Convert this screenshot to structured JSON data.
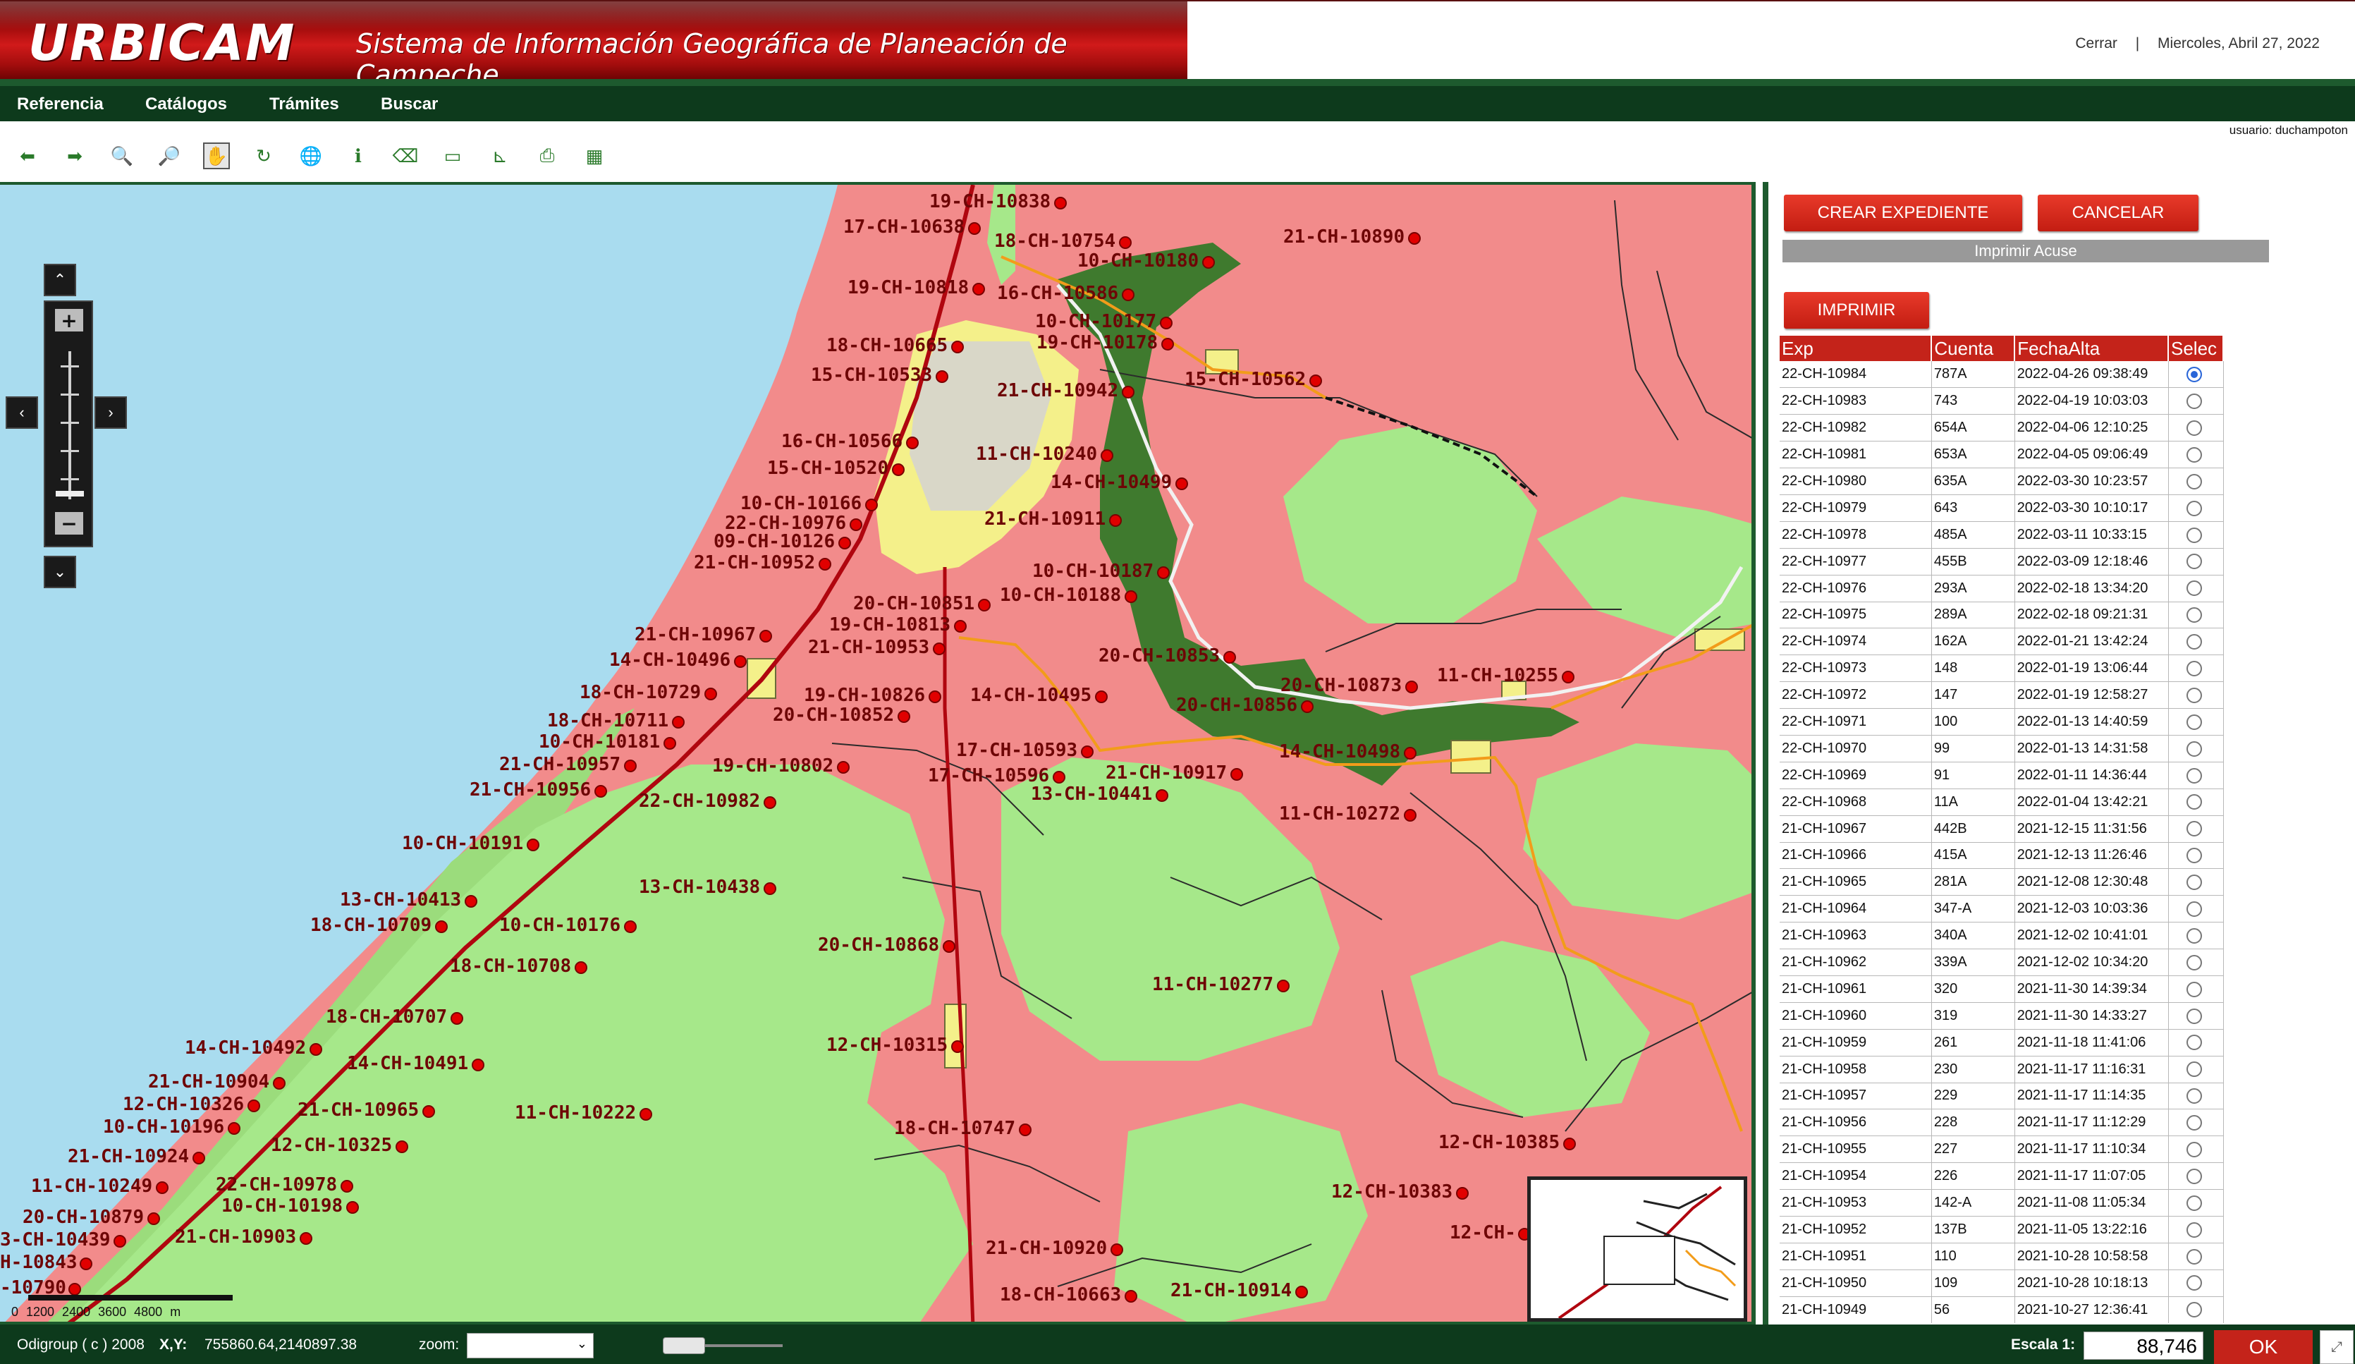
{
  "header": {
    "logo": "URBICAM",
    "subtitle": "Sistema de Información Geográfica de Planeación de Campeche",
    "close_link": "Cerrar",
    "separator": "|",
    "date": "Miercoles, Abril 27, 2022"
  },
  "menu": {
    "items": [
      "Referencia",
      "Catálogos",
      "Trámites",
      "Buscar"
    ]
  },
  "user_label": "usuario: duchampoton",
  "toolbar": {
    "tools": [
      {
        "icon": "arrow-left-icon",
        "glyph": "⬅"
      },
      {
        "icon": "arrow-right-icon",
        "glyph": "➡"
      },
      {
        "icon": "zoom-in-icon",
        "glyph": "🔍"
      },
      {
        "icon": "zoom-out-icon",
        "glyph": "🔎"
      },
      {
        "icon": "pan-hand-icon",
        "glyph": "✋"
      },
      {
        "icon": "refresh-icon",
        "glyph": "↻"
      },
      {
        "icon": "globe-icon",
        "glyph": "🌐"
      },
      {
        "icon": "info-icon",
        "glyph": "ℹ"
      },
      {
        "icon": "eraser-icon",
        "glyph": "⌫"
      },
      {
        "icon": "measure-distance-icon",
        "glyph": "▭"
      },
      {
        "icon": "measure-area-icon",
        "glyph": "⊾"
      },
      {
        "icon": "print-icon",
        "glyph": "⎙"
      },
      {
        "icon": "legend-icon",
        "glyph": "▦"
      }
    ]
  },
  "map": {
    "labels": [
      [
        "19-CH-10838",
        1318,
        290
      ],
      [
        "17-CH-10638",
        1196,
        326
      ],
      [
        "18-CH-10754",
        1410,
        346
      ],
      [
        "10-CH-10180",
        1528,
        374
      ],
      [
        "21-CH-10890",
        1820,
        340
      ],
      [
        "19-CH-10818",
        1202,
        412
      ],
      [
        "16-CH-10586",
        1414,
        420
      ],
      [
        "10-CH-10177",
        1468,
        460
      ],
      [
        "19-CH-10178",
        1470,
        490
      ],
      [
        "18-CH-10665",
        1172,
        494
      ],
      [
        "15-CH-10533",
        1150,
        536
      ],
      [
        "15-CH-10562",
        1680,
        542
      ],
      [
        "21-CH-10942",
        1414,
        558
      ],
      [
        "16-CH-10566",
        1108,
        630
      ],
      [
        "15-CH-10520",
        1088,
        668
      ],
      [
        "11-CH-10240",
        1384,
        648
      ],
      [
        "14-CH-10499",
        1490,
        688
      ],
      [
        "10-CH-10166",
        1050,
        718
      ],
      [
        "22-CH-10976",
        1028,
        746
      ],
      [
        "21-CH-10911",
        1396,
        740
      ],
      [
        "09-CH-10126",
        1012,
        772
      ],
      [
        "21-CH-10952",
        984,
        802
      ],
      [
        "10-CH-10187",
        1464,
        814
      ],
      [
        "10-CH-10188",
        1418,
        848
      ],
      [
        "20-CH-10851",
        1210,
        860
      ],
      [
        "19-CH-10813",
        1176,
        890
      ],
      [
        "21-CH-10967",
        900,
        904
      ],
      [
        "21-CH-10953",
        1146,
        922
      ],
      [
        "14-CH-10496",
        864,
        940
      ],
      [
        "20-CH-10853",
        1558,
        934
      ],
      [
        "11-CH-10255",
        2038,
        962
      ],
      [
        "18-CH-10729",
        822,
        986
      ],
      [
        "19-CH-10826",
        1140,
        990
      ],
      [
        "14-CH-10495",
        1376,
        990
      ],
      [
        "20-CH-10873",
        1816,
        976
      ],
      [
        "20-CH-10852",
        1096,
        1018
      ],
      [
        "20-CH-10856",
        1668,
        1004
      ],
      [
        "18-CH-10711",
        776,
        1026
      ],
      [
        "10-CH-10181",
        764,
        1056
      ],
      [
        "17-CH-10593",
        1356,
        1068
      ],
      [
        "14-CH-10498",
        1814,
        1070
      ],
      [
        "21-CH-10957",
        708,
        1088
      ],
      [
        "19-CH-10802",
        1010,
        1090
      ],
      [
        "17-CH-10596",
        1316,
        1104
      ],
      [
        "21-CH-10917",
        1568,
        1100
      ],
      [
        "21-CH-10956",
        666,
        1124
      ],
      [
        "13-CH-10441",
        1462,
        1130
      ],
      [
        "22-CH-10982",
        906,
        1140
      ],
      [
        "11-CH-10272",
        1814,
        1158
      ],
      [
        "10-CH-10191",
        570,
        1200
      ],
      [
        "13-CH-10438",
        906,
        1262
      ],
      [
        "13-CH-10413",
        482,
        1280
      ],
      [
        "18-CH-10709",
        440,
        1316
      ],
      [
        "10-CH-10176",
        708,
        1316
      ],
      [
        "18-CH-10708",
        638,
        1374
      ],
      [
        "20-CH-10868",
        1160,
        1344
      ],
      [
        "11-CH-10277",
        1634,
        1400
      ],
      [
        "18-CH-10707",
        462,
        1446
      ],
      [
        "12-CH-10315",
        1172,
        1486
      ],
      [
        "14-CH-10492",
        262,
        1490
      ],
      [
        "14-CH-10491",
        492,
        1512
      ],
      [
        "21-CH-10904",
        210,
        1538
      ],
      [
        "12-CH-10326",
        174,
        1570
      ],
      [
        "21-CH-10965",
        422,
        1578
      ],
      [
        "11-CH-10222",
        730,
        1582
      ],
      [
        "10-CH-10196",
        146,
        1602
      ],
      [
        "18-CH-10747",
        1268,
        1604
      ],
      [
        "12-CH-10325",
        384,
        1628
      ],
      [
        "12-CH-10385",
        2040,
        1624
      ],
      [
        "21-CH-10924",
        96,
        1644
      ],
      [
        "11-CH-10249",
        44,
        1686
      ],
      [
        "22-CH-10978",
        306,
        1684
      ],
      [
        "12-CH-10383",
        1888,
        1694
      ],
      [
        "10-CH-10198",
        314,
        1714
      ],
      [
        "20-CH-10879",
        32,
        1730
      ],
      [
        "21-CH-10903",
        248,
        1758
      ],
      [
        "3-CH-10439",
        0,
        1762
      ],
      [
        "12-CH-",
        2056,
        1752
      ],
      [
        "H-10843",
        0,
        1794
      ],
      [
        "21-CH-10920",
        1398,
        1774
      ],
      [
        "21-CH-10914",
        1660,
        1834
      ],
      [
        "18-CH-10663",
        1418,
        1840
      ],
      [
        "-10790",
        0,
        1830
      ]
    ]
  },
  "scale_bar": {
    "ticks": "0 1200 2400 3600 4800 m"
  },
  "panel": {
    "create_button": "CREAR EXPEDIENTE",
    "cancel_button": "CANCELAR",
    "print_ack": "Imprimir Acuse",
    "print_button": "IMPRIMIR",
    "table": {
      "headers": [
        "Exp",
        "Cuenta",
        "FechaAlta",
        "Selec"
      ],
      "rows": [
        [
          "22-CH-10984",
          "787A",
          "2022-04-26 09:38:49",
          true
        ],
        [
          "22-CH-10983",
          "743",
          "2022-04-19 10:03:03",
          false
        ],
        [
          "22-CH-10982",
          "654A",
          "2022-04-06 12:10:25",
          false
        ],
        [
          "22-CH-10981",
          "653A",
          "2022-04-05 09:06:49",
          false
        ],
        [
          "22-CH-10980",
          "635A",
          "2022-03-30 10:23:57",
          false
        ],
        [
          "22-CH-10979",
          "643",
          "2022-03-30 10:10:17",
          false
        ],
        [
          "22-CH-10978",
          "485A",
          "2022-03-11 10:33:15",
          false
        ],
        [
          "22-CH-10977",
          "455B",
          "2022-03-09 12:18:46",
          false
        ],
        [
          "22-CH-10976",
          "293A",
          "2022-02-18 13:34:20",
          false
        ],
        [
          "22-CH-10975",
          "289A",
          "2022-02-18 09:21:31",
          false
        ],
        [
          "22-CH-10974",
          "162A",
          "2022-01-21 13:42:24",
          false
        ],
        [
          "22-CH-10973",
          "148",
          "2022-01-19 13:06:44",
          false
        ],
        [
          "22-CH-10972",
          "147",
          "2022-01-19 12:58:27",
          false
        ],
        [
          "22-CH-10971",
          "100",
          "2022-01-13 14:40:59",
          false
        ],
        [
          "22-CH-10970",
          "99",
          "2022-01-13 14:31:58",
          false
        ],
        [
          "22-CH-10969",
          "91",
          "2022-01-11 14:36:44",
          false
        ],
        [
          "22-CH-10968",
          "11A",
          "2022-01-04 13:42:21",
          false
        ],
        [
          "21-CH-10967",
          "442B",
          "2021-12-15 11:31:56",
          false
        ],
        [
          "21-CH-10966",
          "415A",
          "2021-12-13 11:26:46",
          false
        ],
        [
          "21-CH-10965",
          "281A",
          "2021-12-08 12:30:48",
          false
        ],
        [
          "21-CH-10964",
          "347-A",
          "2021-12-03 10:03:36",
          false
        ],
        [
          "21-CH-10963",
          "340A",
          "2021-12-02 10:41:01",
          false
        ],
        [
          "21-CH-10962",
          "339A",
          "2021-12-02 10:34:20",
          false
        ],
        [
          "21-CH-10961",
          "320",
          "2021-11-30 14:39:34",
          false
        ],
        [
          "21-CH-10960",
          "319",
          "2021-11-30 14:33:27",
          false
        ],
        [
          "21-CH-10959",
          "261",
          "2021-11-18 11:41:06",
          false
        ],
        [
          "21-CH-10958",
          "230",
          "2021-11-17 11:16:31",
          false
        ],
        [
          "21-CH-10957",
          "229",
          "2021-11-17 11:14:35",
          false
        ],
        [
          "21-CH-10956",
          "228",
          "2021-11-17 11:12:29",
          false
        ],
        [
          "21-CH-10955",
          "227",
          "2021-11-17 11:10:34",
          false
        ],
        [
          "21-CH-10954",
          "226",
          "2021-11-17 11:07:05",
          false
        ],
        [
          "21-CH-10953",
          "142-A",
          "2021-11-08 11:05:34",
          false
        ],
        [
          "21-CH-10952",
          "137B",
          "2021-11-05 13:22:16",
          false
        ],
        [
          "21-CH-10951",
          "110",
          "2021-10-28 10:58:58",
          false
        ],
        [
          "21-CH-10950",
          "109",
          "2021-10-28 10:18:13",
          false
        ],
        [
          "21-CH-10949",
          "56",
          "2021-10-27 12:36:41",
          false
        ]
      ]
    }
  },
  "footer": {
    "copyright": "Odigroup ( c ) 2008",
    "coords_label": "X,Y:",
    "coords_value": "755860.64,2140897.38",
    "zoom_label": "zoom:",
    "zoom_value": "",
    "scale_label": "Escala 1:",
    "scale_value": "88,746",
    "ok_button": "OK"
  },
  "colors": {
    "brand_red": "#c4231a",
    "dark_green": "#0d3a1c",
    "urban_pink": "#f28b8b",
    "vegetation_green": "#a6e88a",
    "mangrove_green": "#3f7a2e",
    "sea_blue": "#a9dcef",
    "settlement_yellow": "#f4f08a"
  }
}
